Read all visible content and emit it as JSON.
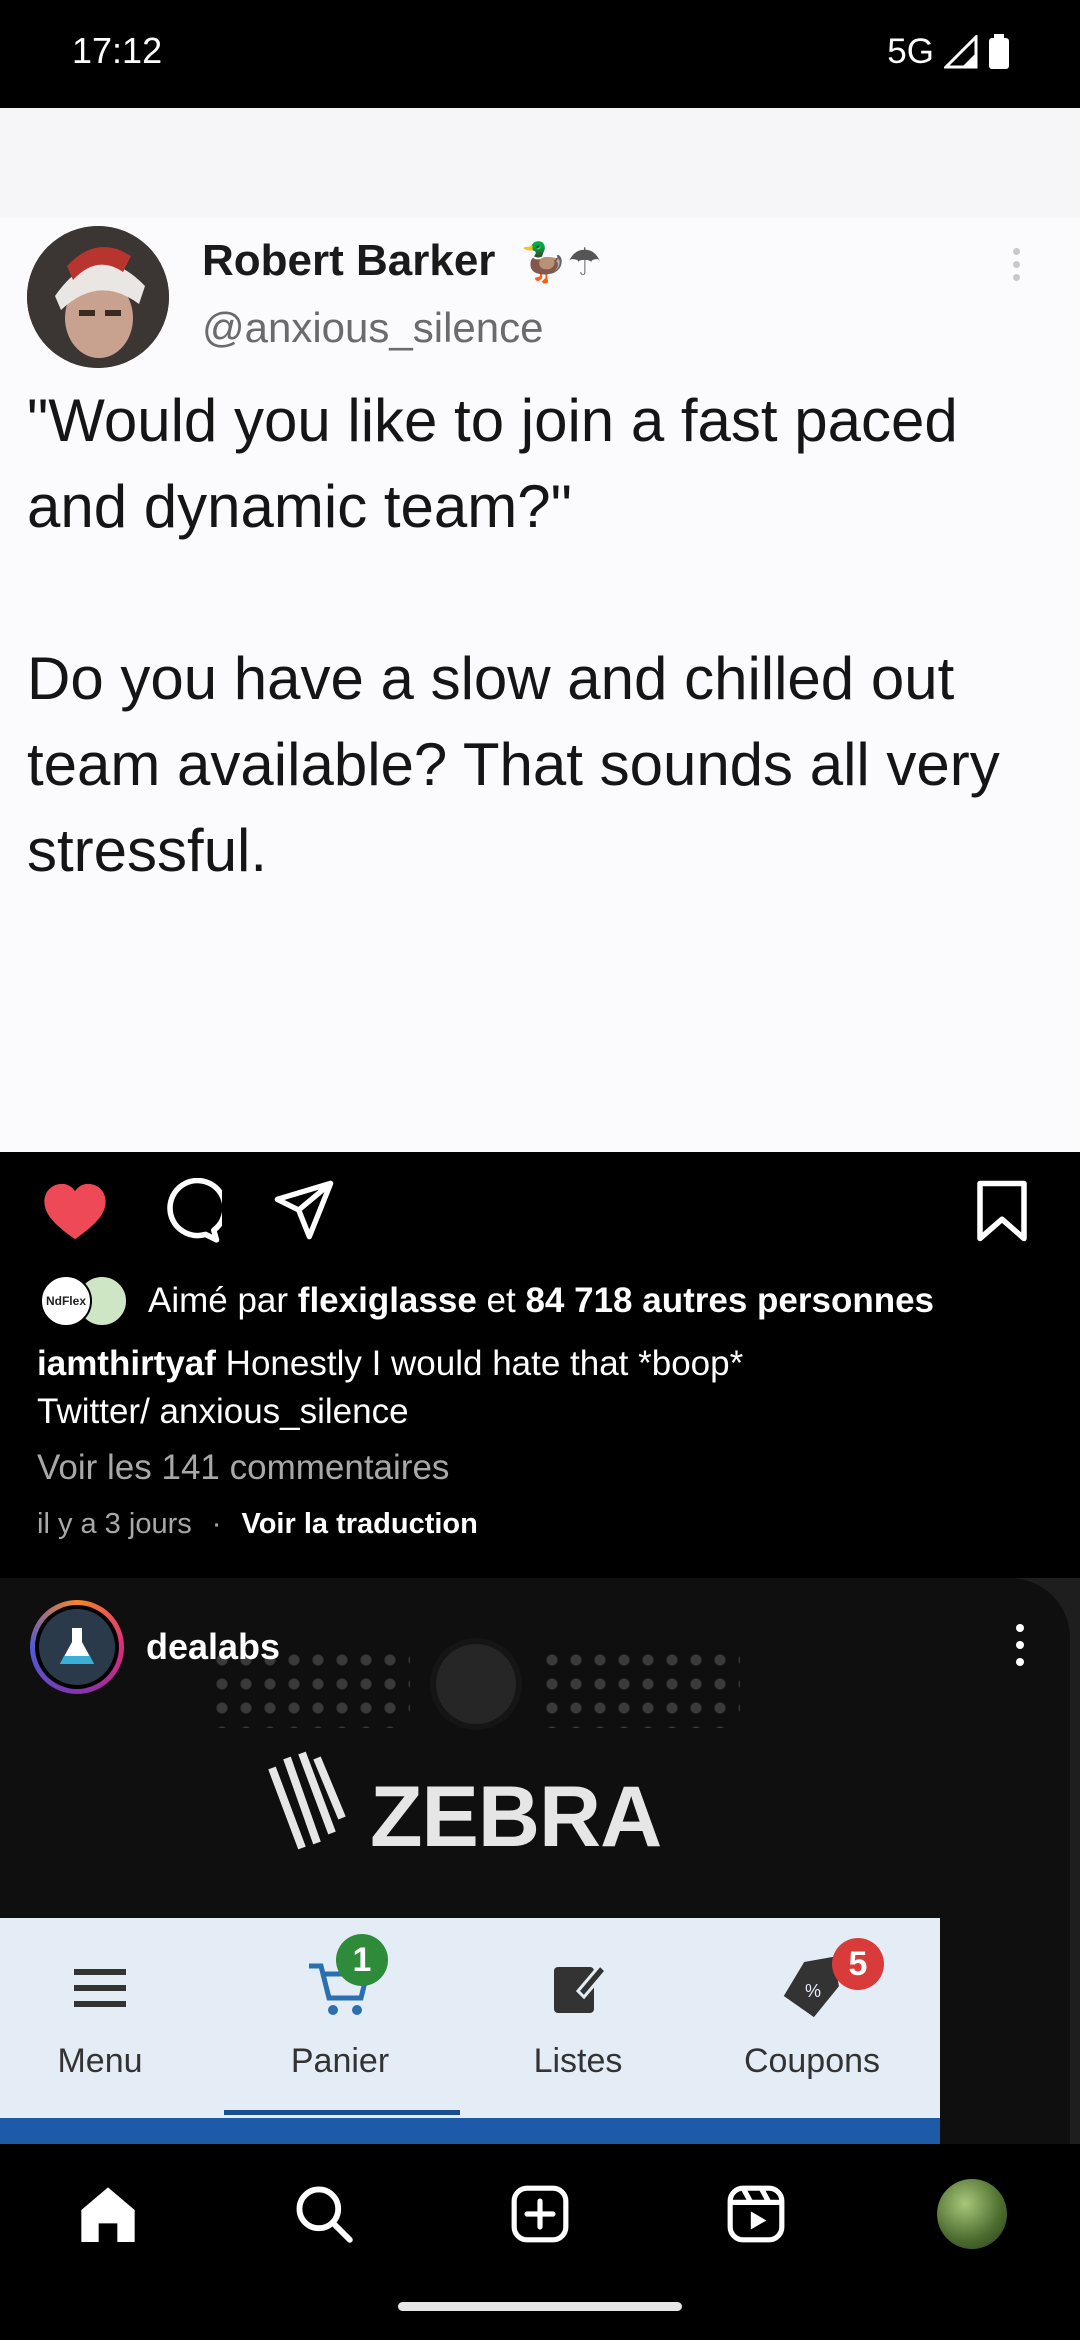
{
  "status_bar": {
    "time": "17:12",
    "network": "5G"
  },
  "post1": {
    "tweet": {
      "name": "Robert Barker",
      "name_emoji": "🦆☂",
      "handle": "@anxious_silence",
      "line1": "\"Would you like to join a fast paced and dynamic team?\"",
      "line2": "Do you have a slow and chilled out team available? That sounds all very stressful."
    },
    "likes": {
      "prefix": "Aimé par",
      "liker": "flexiglasse",
      "joiner": "et",
      "others": "84 718 autres personnes",
      "mini_avatar_label": "NdFlex"
    },
    "caption": {
      "username": "iamthirtyaf",
      "text": "Honestly I would hate that *boop*",
      "line2": "Twitter/ anxious_silence"
    },
    "comments_link": "Voir les 141 commentaires",
    "time_ago": "il y a 3 jours",
    "translate": "Voir la traduction"
  },
  "post2": {
    "username": "dealabs",
    "brand": "ZEBRA",
    "screen_tabs": [
      {
        "label": "Menu",
        "icon": "hamburger-icon"
      },
      {
        "label": "Panier",
        "icon": "cart-icon",
        "badge": "1"
      },
      {
        "label": "Listes",
        "icon": "list-edit-icon"
      },
      {
        "label": "Coupons",
        "icon": "coupon-tag-icon",
        "badge": "5"
      }
    ]
  },
  "bottom_nav": [
    "home-icon",
    "search-icon",
    "create-icon",
    "reels-icon",
    "profile-avatar"
  ],
  "colors": {
    "like": "#ed4956",
    "badge_green": "#2e8b3a",
    "badge_red": "#d93a3a"
  }
}
